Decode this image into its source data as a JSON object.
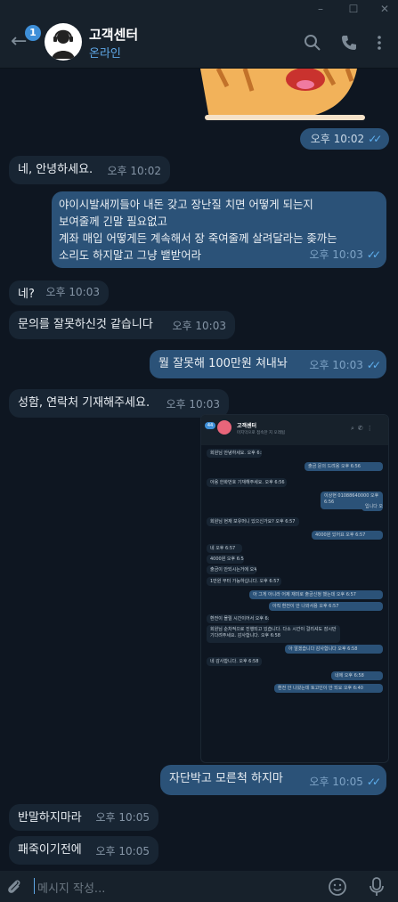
{
  "header": {
    "title": "고객센터",
    "status": "온라인",
    "unread_badge": "1"
  },
  "sticker_time": "오후 10:02",
  "messages": [
    {
      "dir": "in",
      "text": "네, 안녕하세요.",
      "time": "오후 10:02"
    },
    {
      "dir": "out",
      "line1": "야이시발새끼들아 내돈 갖고 장난질 치면 어떻게 되는지",
      "line2": "보여줄께 긴말 필요없고",
      "line3": " 계좌 매입 어떻게든 계속해서 장 죽여줄께  살려달라는 좆까는",
      "line4": "소리도 하지말고  그냥 뱉받어라",
      "time": "오후 10:03"
    },
    {
      "dir": "in",
      "text": "네?",
      "time": "오후 10:03"
    },
    {
      "dir": "in",
      "text": "문의를 잘못하신것 같습니다",
      "time": "오후 10:03"
    },
    {
      "dir": "out",
      "text": "뭘 잘못해 100만원 쳐내놔",
      "time": "오후 10:03"
    },
    {
      "dir": "in",
      "text": "성함, 연락처 기재해주세요.",
      "time": "오후 10:03"
    },
    {
      "dir": "out",
      "text": "자단박고 모른척 하지마",
      "time": "오후 10:05"
    },
    {
      "dir": "in",
      "text": "반말하지마라",
      "time": "오후 10:05"
    },
    {
      "dir": "in",
      "text": "패죽이기전에",
      "time": "오후 10:05"
    }
  ],
  "screenshot": {
    "title": "고객센터",
    "subtitle": "마지막으로 접속한 지 오래됨",
    "badge": "44",
    "rows": [
      {
        "dir": "in",
        "text": "회원님 안녕하세요.  오후 6:55"
      },
      {
        "dir": "out",
        "text": "출금 문의 드려용  오후 6:56"
      },
      {
        "dir": "in",
        "text": "아용 한화번호 기재해주세요.  오후 6:56"
      },
      {
        "dir": "out",
        "text": "이상현 01088640000  오후 6:56"
      },
      {
        "dir": "out",
        "text": "입니다  오후 6:56"
      },
      {
        "dir": "in",
        "text": "회원님 현재 보유머니 있으신가요?  오후 6:57"
      },
      {
        "dir": "out",
        "text": "4000원 있어요  오후 6:57"
      },
      {
        "dir": "in",
        "text": "네  오후 6:57"
      },
      {
        "dir": "in",
        "text": "4000원  오후 6:57"
      },
      {
        "dir": "in",
        "text": "출금이 안되시는거에  오후 6:57"
      },
      {
        "dir": "in",
        "text": "1만원 부터 가능하십니다.  오후 6:57"
      },
      {
        "dir": "out",
        "text": "아 그게 아니라 어제 재미로 출금신청 했는데  오후 6:57"
      },
      {
        "dir": "out",
        "text": "아직 환전이 안 나와서용  오후 6:57"
      },
      {
        "dir": "in",
        "text": "환전이 몰릴 시간이어서  오후 6:58"
      },
      {
        "dir": "in",
        "text": "회원님 순차적으로 진행되고 있습니다. 다소 시간이 걸리셔도 잠시만 기다려주세요. 감사합니다.  오후 6:58"
      },
      {
        "dir": "out",
        "text": "아 알겠습니다 감사합니다  오후 6:58"
      },
      {
        "dir": "in",
        "text": "네 감사합니다.  오후 6:58"
      },
      {
        "dir": "out",
        "text": "네에  오후 6:58"
      },
      {
        "dir": "out",
        "text": "환전 안 나왔는데 토고인이 안 되요  오후 6:40"
      }
    ]
  },
  "composer": {
    "placeholder": "메시지 작성..."
  },
  "colors": {
    "background": "#0e1621",
    "header": "#17212b",
    "incoming": "#182533",
    "outgoing": "#2b5278",
    "accent": "#5fa7e6"
  }
}
